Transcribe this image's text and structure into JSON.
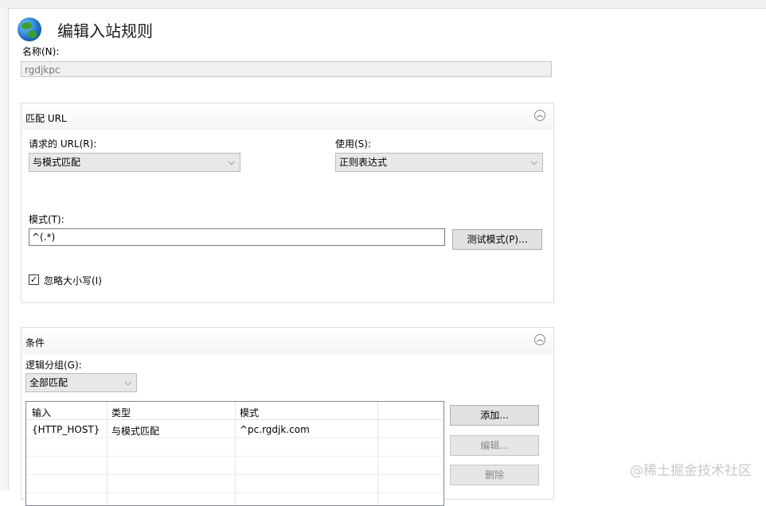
{
  "header": {
    "title": "编辑入站规则",
    "icon": "globe-icon"
  },
  "name_field": {
    "label": "名称(N):",
    "value": "rgdjkpc"
  },
  "match_url": {
    "title": "匹配 URL",
    "requested_url": {
      "label": "请求的 URL(R):",
      "value": "与模式匹配"
    },
    "using": {
      "label": "使用(S):",
      "value": "正则表达式"
    },
    "pattern": {
      "label": "模式(T):",
      "value": "^(.*)"
    },
    "test_button": "测试模式(P)...",
    "ignore_case": {
      "label": "忽略大小写(I)",
      "checked": true
    }
  },
  "conditions": {
    "title": "条件",
    "logical_grouping": {
      "label": "逻辑分组(G):",
      "value": "全部匹配"
    },
    "columns": [
      "输入",
      "类型",
      "模式"
    ],
    "rows": [
      {
        "input": "{HTTP_HOST}",
        "type": "与模式匹配",
        "pattern": "^pc.rgdjk.com"
      }
    ],
    "buttons": {
      "add": "添加...",
      "edit": "编辑...",
      "delete": "删除"
    }
  },
  "watermark": "@稀土掘金技术社区"
}
